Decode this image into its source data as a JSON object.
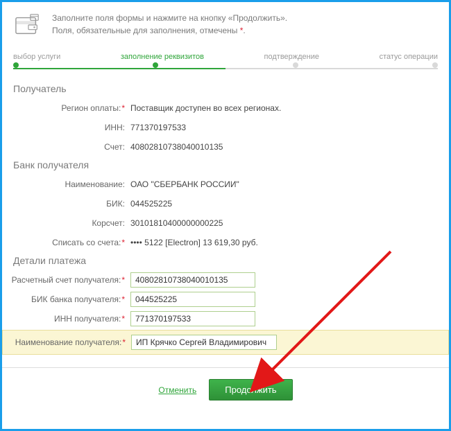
{
  "header": {
    "line1_a": "Заполните поля формы и нажмите на кнопку «Продолжить».",
    "line2_a": "Поля, обязательные для заполнения, отмечены ",
    "line2_req": "*",
    "line2_b": "."
  },
  "stepper": {
    "step1": "выбор услуги",
    "step2": "заполнение реквизитов",
    "step3": "подтверждение",
    "step4": "статус операции"
  },
  "sections": {
    "recipient": "Получатель",
    "bank": "Банк получателя",
    "details": "Детали платежа"
  },
  "recipient": {
    "region_label": "Регион оплаты:",
    "region_value": "Поставщик доступен во всех регионах.",
    "inn_label": "ИНН:",
    "inn_value": "771370197533",
    "account_label": "Счет:",
    "account_value": "40802810738040010135"
  },
  "bank": {
    "name_label": "Наименование:",
    "name_value": "ОАО \"СБЕРБАНК РОССИИ\"",
    "bik_label": "БИК:",
    "bik_value": "044525225",
    "corr_label": "Корсчет:",
    "corr_value": "30101810400000000225",
    "from_label": "Списать со счета:",
    "from_value": "•••• 5122  [Electron] 13 619,30  руб."
  },
  "details": {
    "acct_label": "Расчетный счет получателя:",
    "acct_value": "40802810738040010135",
    "bik_label": "БИК банка получателя:",
    "bik_value": "044525225",
    "inn_label": "ИНН получателя:",
    "inn_value": "771370197533",
    "name_label": "Наименование получателя:",
    "name_value": "ИП Крячко Сергей Владимирович"
  },
  "actions": {
    "cancel": "Отменить",
    "continue": "Продолжить"
  }
}
